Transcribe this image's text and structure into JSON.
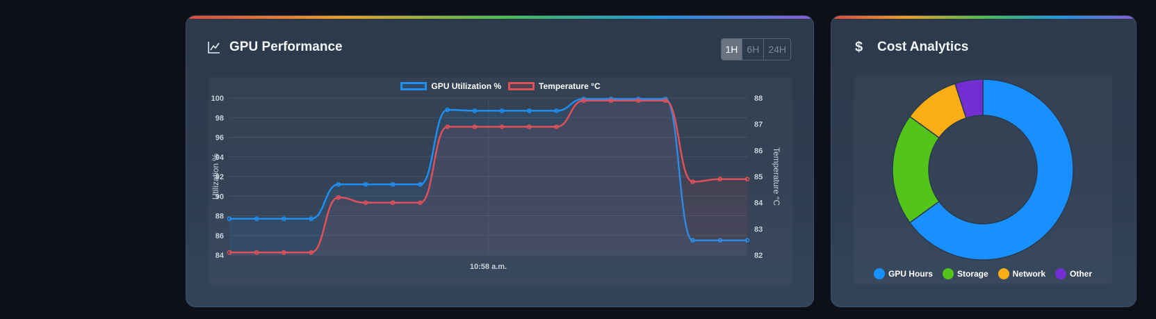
{
  "performance": {
    "title": "GPU Performance",
    "title_icon": "line-chart-icon",
    "ranges": [
      {
        "label": "1H",
        "active": true
      },
      {
        "label": "6H",
        "active": false
      },
      {
        "label": "24H",
        "active": false
      }
    ]
  },
  "cost": {
    "title": "Cost Analytics",
    "title_icon": "dollar-icon",
    "title_icon_glyph": "$"
  },
  "chart_data": [
    {
      "type": "line",
      "title": "",
      "x_ticks": [
        "10:58 a.m."
      ],
      "ylabel": "Utilization %",
      "y2label": "Temperature °C",
      "ylim": [
        84,
        100
      ],
      "y2lim": [
        82,
        88
      ],
      "y_ticks": [
        "84",
        "86",
        "88",
        "90",
        "92",
        "94",
        "96",
        "98",
        "100"
      ],
      "y2_ticks": [
        "82",
        "83",
        "84",
        "85",
        "86",
        "87",
        "88"
      ],
      "grid": true,
      "legend": "top-center",
      "series": [
        {
          "name": "GPU Utilization %",
          "axis": "left",
          "color": "#1e8ff0",
          "values": [
            87.7,
            87.7,
            87.7,
            87.7,
            91.2,
            91.2,
            91.2,
            91.2,
            98.8,
            98.7,
            98.7,
            98.7,
            98.7,
            99.9,
            99.9,
            99.9,
            99.9,
            85.5,
            85.5,
            85.5
          ]
        },
        {
          "name": "Temperature °C",
          "axis": "right",
          "color": "#e05058",
          "values": [
            82.1,
            82.1,
            82.1,
            82.1,
            84.2,
            84.0,
            84.0,
            84.0,
            86.9,
            86.9,
            86.9,
            86.9,
            86.9,
            87.9,
            87.9,
            87.9,
            87.9,
            84.8,
            84.9,
            84.9
          ]
        }
      ]
    },
    {
      "type": "pie",
      "donut": true,
      "legend": "bottom",
      "categories": [
        "GPU Hours",
        "Storage",
        "Network",
        "Other"
      ],
      "values": [
        65,
        20,
        10,
        5
      ],
      "colors": [
        "#1890ff",
        "#52c41a",
        "#faad14",
        "#722ed1"
      ]
    }
  ]
}
